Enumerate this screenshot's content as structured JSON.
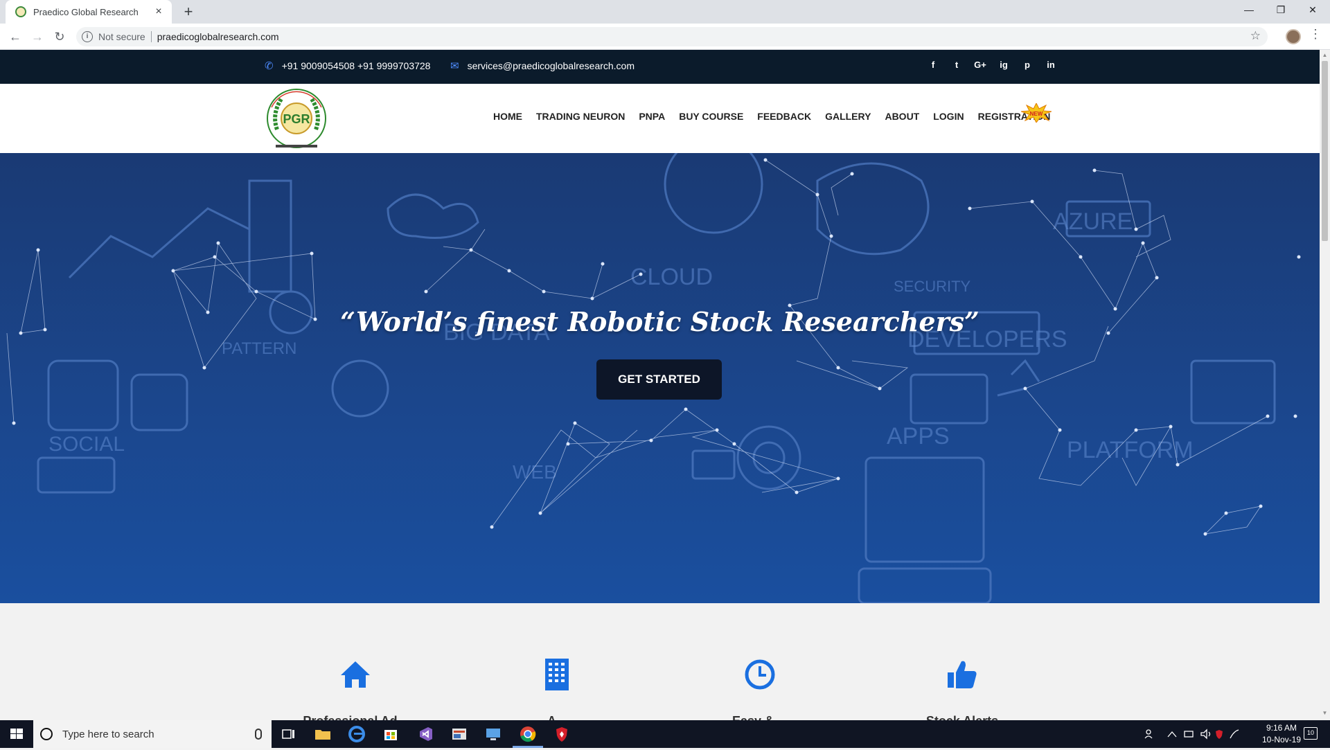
{
  "browser": {
    "tab_title": "Praedico Global Research",
    "tab_close": "×",
    "new_tab": "+",
    "not_secure": "Not secure",
    "url": "praedicoglobalresearch.com"
  },
  "topbar": {
    "phone": "+91 9009054508 +91 9999703728",
    "email": "services@praedicoglobalresearch.com",
    "social": [
      "f",
      "t",
      "G+",
      "ig",
      "p",
      "in"
    ]
  },
  "header": {
    "logo_text": "PGR",
    "nav": [
      "HOME",
      "TRADING NEURON",
      "PNPA",
      "BUY COURSE",
      "FEEDBACK",
      "GALLERY",
      "ABOUT",
      "LOGIN",
      "REGISTRATION"
    ],
    "new_badge": "NEW"
  },
  "hero": {
    "tagline": "“World’s finest Robotic Stock Researchers”",
    "cta": "GET STARTED"
  },
  "features": [
    {
      "label": "Professional Ad..."
    },
    {
      "label": "A..."
    },
    {
      "label": "Easy & ..."
    },
    {
      "label": "Stock Alerts"
    }
  ],
  "taskbar": {
    "search_placeholder": "Type here to search",
    "time": "9:16 AM",
    "date": "10-Nov-19",
    "notifications": "10"
  },
  "colors": {
    "topbar_bg": "#0b1b2b",
    "hero_bg": "#1b468c",
    "accent_blue": "#1a6fe0",
    "cta_bg": "#0d1628"
  }
}
